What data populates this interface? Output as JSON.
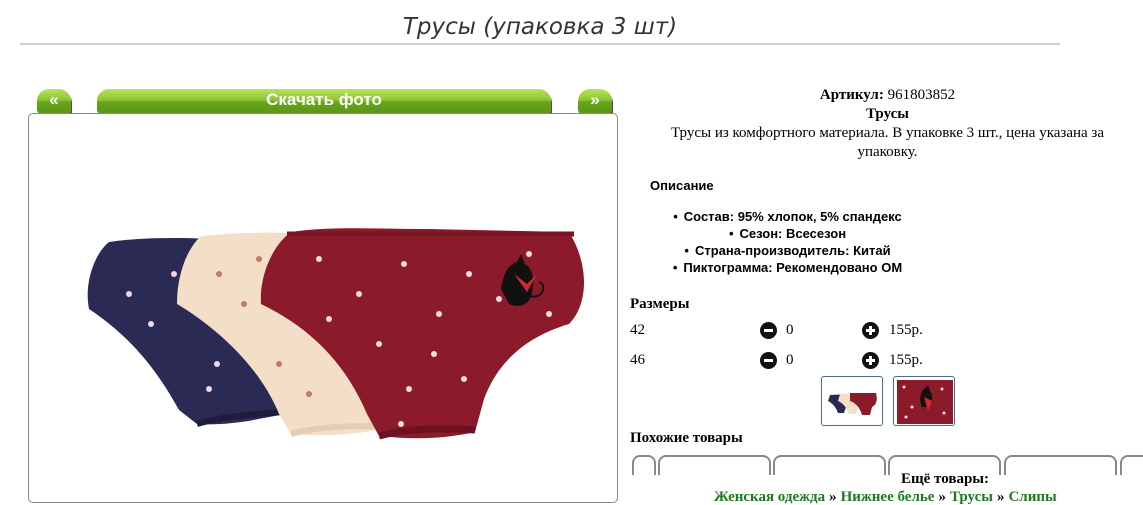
{
  "page": {
    "title": "Трусы (упаковка 3 шт)"
  },
  "gallery": {
    "prev_label": "«",
    "download_label": "Скачать фото",
    "next_label": "»",
    "photo_colors": [
      "#2b2a55",
      "#f3dfc8",
      "#8b1a2b"
    ]
  },
  "product": {
    "sku_label": "Артикул:",
    "sku_value": "961803852",
    "name": "Трусы",
    "short_description": "Трусы из комфортного материала. В упаковке 3 шт., цена указана за упаковку.",
    "description_heading": "Описание",
    "properties": [
      "Состав: 95% хлопок, 5% спандекс",
      "Сезон: Всесезон",
      "Страна-производитель: Китай",
      "Пиктограмма: Рекомендовано ОМ"
    ]
  },
  "sizes": {
    "heading": "Размеры",
    "rows": [
      {
        "size": "42",
        "qty": "0",
        "price": "155р."
      },
      {
        "size": "46",
        "qty": "0",
        "price": "155р."
      }
    ]
  },
  "similar": {
    "heading": "Похожие товары"
  },
  "more": {
    "heading": "Ещё товары:",
    "breadcrumbs": [
      "Женская одежда",
      "Нижнее белье",
      "Трусы",
      "Слипы"
    ],
    "separator": "»"
  }
}
